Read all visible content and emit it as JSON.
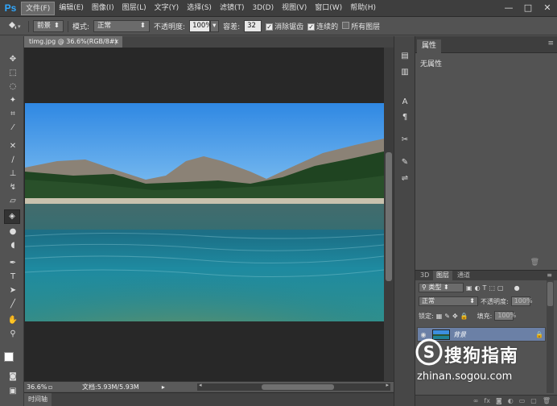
{
  "app": {
    "logo": "Ps",
    "accent": "#31a8ff"
  },
  "menu": {
    "items": [
      "文件(F)",
      "编辑(E)",
      "图像(I)",
      "图层(L)",
      "文字(Y)",
      "选择(S)",
      "滤镜(T)",
      "3D(D)",
      "视图(V)",
      "窗口(W)",
      "帮助(H)"
    ],
    "active_index": 0
  },
  "window_controls": {
    "minimize": "—",
    "restore": "□",
    "close": "✕"
  },
  "options": {
    "tool_icon": "paint-bucket-icon",
    "fill_source": "前景",
    "mode_label": "模式:",
    "mode_value": "正常",
    "opacity_label": "不透明度:",
    "opacity_value": "100%",
    "tolerance_label": "容差:",
    "tolerance_value": "32",
    "antialias_label": "消除锯齿",
    "antialias_checked": true,
    "contiguous_label": "连续的",
    "contiguous_checked": true,
    "all_layers_label": "所有图层",
    "all_layers_checked": false
  },
  "document": {
    "tab_title": "timg.jpg @ 36.6%(RGB/8#)",
    "tab_close": "×",
    "zoom": "36.6%",
    "doc_info": "文档:5.93M/5.93M",
    "timeline_label": "时间轴"
  },
  "properties": {
    "tab": "属性",
    "body_text": "无属性"
  },
  "layers": {
    "tabs": [
      "3D",
      "图层",
      "通道"
    ],
    "active_tab": 1,
    "filter_type": "类型",
    "blend_mode": "正常",
    "opacity_label": "不透明度:",
    "opacity_value": "100%",
    "lock_label": "锁定:",
    "fill_label": "填充:",
    "fill_value": "100%",
    "layer_name": "背景"
  },
  "watermark": {
    "text": "搜狗指南",
    "url": "zhinan.sogou.com"
  }
}
